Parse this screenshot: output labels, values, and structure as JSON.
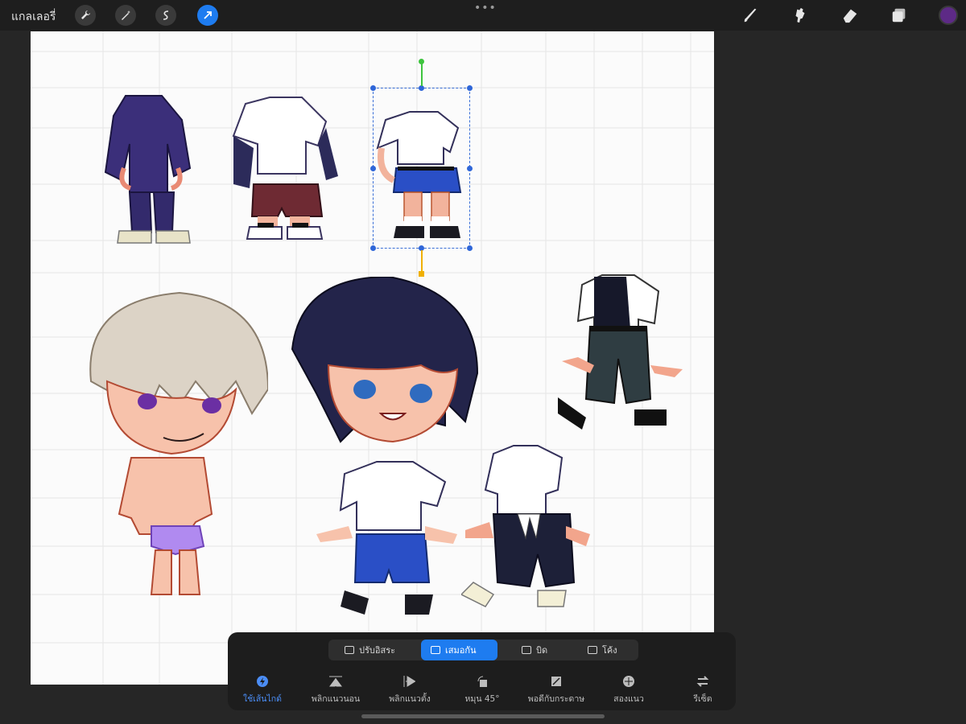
{
  "topbar": {
    "gallery_label": "แกลเลอรี่",
    "tools": [
      "wrench-icon",
      "magic-wand-icon",
      "selection-icon",
      "transform-arrow-icon"
    ],
    "right_tools": [
      "brush-icon",
      "smudge-icon",
      "eraser-icon",
      "layers-icon",
      "color-swatch"
    ],
    "dots": "•••",
    "active_color": "#5d2a86",
    "accent": "#1e7cf0"
  },
  "transform": {
    "modes": [
      {
        "label": "ปรับอิสระ",
        "active": false
      },
      {
        "label": "เสมอกัน",
        "active": true
      },
      {
        "label": "บิด",
        "active": false
      },
      {
        "label": "โค้ง",
        "active": false
      }
    ],
    "actions": [
      {
        "label": "ใช้เส้นไกด์",
        "icon": "snap-icon"
      },
      {
        "label": "พลิกแนวนอน",
        "icon": "flip-horizontal-icon"
      },
      {
        "label": "พลิกแนวตั้ง",
        "icon": "flip-vertical-icon"
      },
      {
        "label": "หมุน 45°",
        "icon": "rotate-45-icon"
      },
      {
        "label": "พอดีกับกระดาษ",
        "icon": "fit-to-canvas-icon"
      },
      {
        "label": "สองแนว",
        "icon": "bilinear-icon"
      },
      {
        "label": "รีเซ็ต",
        "icon": "reset-icon"
      }
    ]
  },
  "canvas": {
    "items": [
      "navy-jacket-outfit",
      "white-shirt-maroon-shorts-outfit",
      "school-uniform-blue-shorts-outfit-selected",
      "black-vest-green-shorts-outfit",
      "blonde-chibi-boy",
      "dark-haired-chibi-boy-in-uniform",
      "white-shirt-black-pants-outfit"
    ]
  }
}
